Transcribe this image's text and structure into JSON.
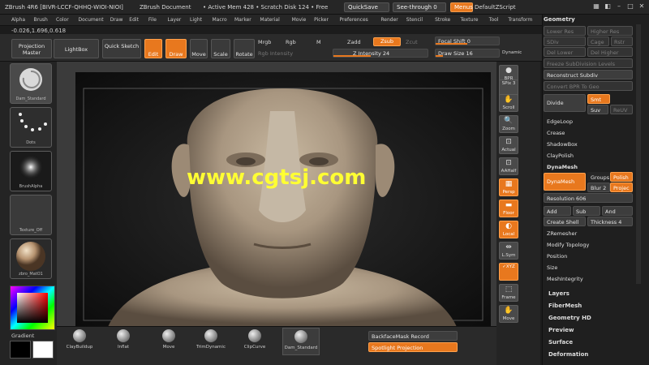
{
  "titlebar": {
    "app": "ZBrush 4R6 [BIVR-LCCF-QHHQ-WIOI-NIOI]",
    "document": "ZBrush Document",
    "stats": "• Active Mem 428 • Scratch Disk 124 • Free",
    "quicksave": "QuickSave",
    "seethrough": "See-through  0",
    "menus": "Menus",
    "script": "DefaultZScript"
  },
  "menubar": [
    "Alpha",
    "Brush",
    "Color",
    "Document",
    "Draw",
    "Edit",
    "File",
    "Layer",
    "Light",
    "Macro",
    "Marker",
    "Material",
    "Movie",
    "Picker",
    "Preferences",
    "Render",
    "Stencil",
    "Stroke",
    "Texture",
    "Tool",
    "Transform",
    "Zplugin",
    "Zscript"
  ],
  "coords": "-0.026,1.696,0.618",
  "toolbar": {
    "projection_master": "Projection Master",
    "lightbox": "LightBox",
    "quick_sketch": "Quick Sketch",
    "edit": "Edit",
    "draw": "Draw",
    "move": "Move",
    "scale": "Scale",
    "rotate": "Rotate",
    "mrgb": "Mrgb",
    "rgb": "Rgb",
    "m": "M",
    "zadd": "Zadd",
    "zsub": "Zsub",
    "zcut": "Zcut",
    "rgb_intensity": "Rgb Intensity",
    "z_intensity": "Z Intensity 24",
    "focal_shift": "Focal Shift 0",
    "draw_size": "Draw Size 16",
    "dynamic": "Dynamic"
  },
  "left_shelf": {
    "brush1": "Dam_Standard",
    "brush2": "Dots",
    "brush3": "BrushAlpha",
    "brush4": "Texture_Off",
    "brush5": "zbro_MatO1",
    "gradient": "Gradient"
  },
  "watermark": "www.cgtsj.com",
  "right_shelf": [
    {
      "name": "bpr-button",
      "label": "BPR",
      "icon": "●",
      "on": false
    },
    {
      "name": "spix",
      "label": "SPix 3",
      "icon": "",
      "on": false
    },
    {
      "name": "scroll-button",
      "label": "Scroll",
      "icon": "✋",
      "on": false
    },
    {
      "name": "zoom-button",
      "label": "Zoom",
      "icon": "🔍",
      "on": false
    },
    {
      "name": "actual-button",
      "label": "Actual",
      "icon": "⊡",
      "on": false
    },
    {
      "name": "aahalf-button",
      "label": "AAHalf",
      "icon": "⊡",
      "on": false
    },
    {
      "name": "persp-button",
      "label": "Persp",
      "icon": "▦",
      "on": true
    },
    {
      "name": "floor-button",
      "label": "Floor",
      "icon": "▬",
      "on": true
    },
    {
      "name": "local-button",
      "label": "Local",
      "icon": "◐",
      "on": true
    },
    {
      "name": "lsym-button",
      "label": "L.Sym",
      "icon": "⇹",
      "on": false
    },
    {
      "name": "xyz-button",
      "label": "✓XYZ",
      "icon": "",
      "on": true
    },
    {
      "name": "frame-button",
      "label": "Frame",
      "icon": "⬚",
      "on": false
    },
    {
      "name": "move-view-button",
      "label": "Move",
      "icon": "✋",
      "on": false
    }
  ],
  "geometry_panel": {
    "title": "Geometry",
    "lower_res": "Lower Res",
    "higher_res": "Higher Res",
    "sdiv": "SDiv",
    "cage": "Cage",
    "rstr": "Rstr",
    "del_lower": "Del Lower",
    "del_higher": "Del Higher",
    "freeze": "Freeze SubDivision Levels",
    "reconstruct": "Reconstruct Subdiv",
    "convert": "Convert BPR To Geo",
    "divide": "Divide",
    "smt": "Smt",
    "suv": "Suv",
    "reuv": "ReUV",
    "edgeloop": "EdgeLoop",
    "crease": "Crease",
    "shadowbox": "ShadowBox",
    "claypolish": "ClayPolish",
    "dynamesh_header": "DynaMesh",
    "dynamesh_btn": "DynaMesh",
    "groups": "Groups",
    "polish": "Polish",
    "blur": "Blur 2",
    "project": "Projec",
    "resolution": "Resolution 606",
    "add": "Add",
    "sub": "Sub",
    "and": "And",
    "create_shell": "Create Shell",
    "thickness": "Thickness 4",
    "zremesher": "ZRemesher",
    "modify_topology": "Modify Topology",
    "position": "Position",
    "size": "Size",
    "meshintegrity": "MeshIntegrity"
  },
  "subpanels": [
    "Layers",
    "FiberMesh",
    "Geometry HD",
    "Preview",
    "Surface",
    "Deformation"
  ],
  "bottom_brushes": [
    "ClayBuildup",
    "Inflat",
    "Move",
    "TrimDynamic",
    "ClipCurve",
    "Dam_Standard"
  ],
  "bottom_toggles": {
    "backface": "BackfaceMask Record",
    "spotlight": "Spotlight Projection"
  },
  "colors": {
    "accent": "#e8781e",
    "watermark": "#ffff33",
    "skin": "#b6a58e"
  }
}
